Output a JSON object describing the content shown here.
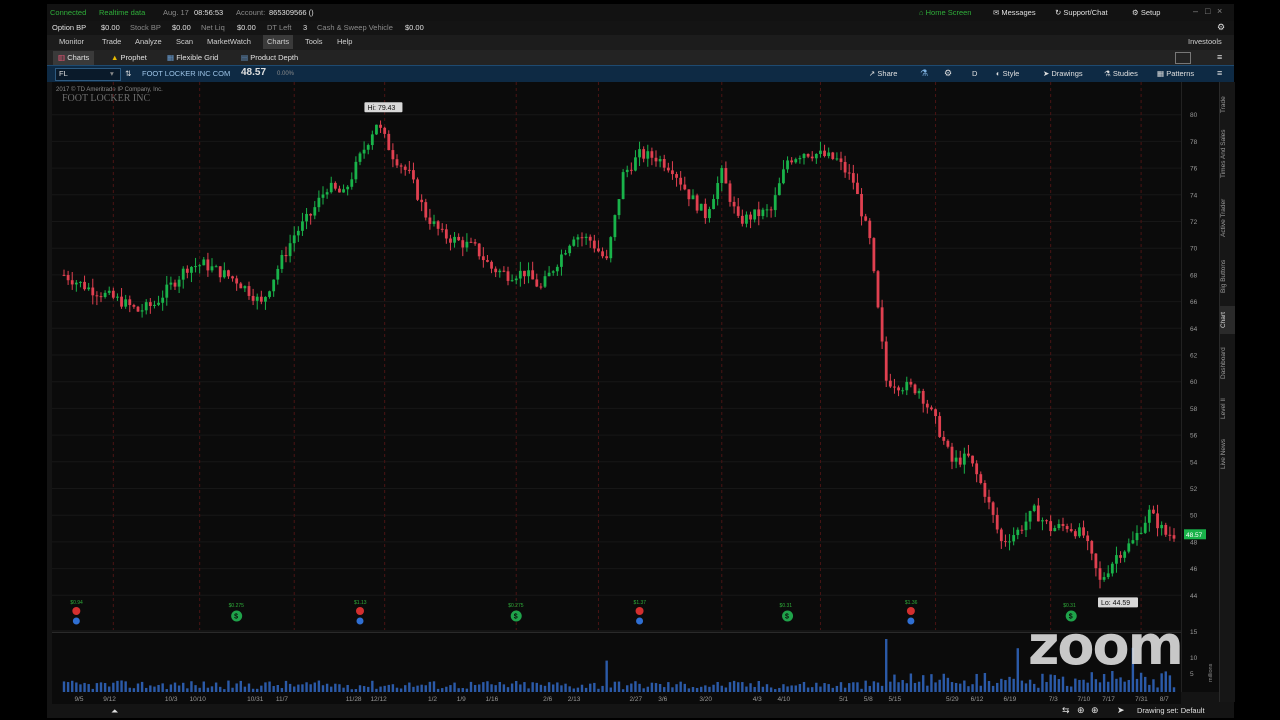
{
  "status": {
    "connected": "Connected",
    "realtime": "Realtime data",
    "date": "Aug. 17",
    "time": "08:56:53",
    "account_label": "Account:",
    "account_value": "865309566 ()"
  },
  "top_right": {
    "home_screen": "Home Screen",
    "messages": "Messages",
    "support": "Support/Chat",
    "setup": "Setup"
  },
  "balances": [
    {
      "label": "Option BP",
      "value": "$0.00"
    },
    {
      "label": "Stock BP",
      "value": "$0.00"
    },
    {
      "label": "Net Liq",
      "value": "$0.00"
    },
    {
      "label": "DT Left",
      "value": "3"
    },
    {
      "label": "Cash & Sweep Vehicle",
      "value": "$0.00"
    }
  ],
  "menu": [
    "Monitor",
    "Trade",
    "Analyze",
    "Scan",
    "MarketWatch",
    "Charts",
    "Tools",
    "Help"
  ],
  "menu_active": "Charts",
  "user_label": "Investools",
  "subtabs": [
    "Charts",
    "Prophet",
    "Flexible Grid",
    "Product Depth"
  ],
  "symbol_bar": {
    "symbol": "FL",
    "company": "FOOT LOCKER INC COM",
    "price": "48.57",
    "change": "0.00%",
    "period": "D",
    "buttons": [
      "Share",
      "Style",
      "Drawings",
      "Studies",
      "Patterns"
    ]
  },
  "chart_header": {
    "copyright": "2017 © TD Ameritrade IP Company, Inc.",
    "name": "FOOT LOCKER INC"
  },
  "chart_data": {
    "type": "candlestick",
    "title": "FOOT LOCKER INC",
    "ylim": [
      42,
      82
    ],
    "yticks": [
      44,
      46,
      48,
      50,
      52,
      54,
      56,
      58,
      60,
      62,
      64,
      66,
      68,
      70,
      72,
      74,
      76,
      78,
      80
    ],
    "xticks": [
      "9/5",
      "9/12",
      "10/3",
      "10/10",
      "10/31",
      "11/7",
      "11/28",
      "12/12",
      "1/2",
      "1/9",
      "1/16",
      "2/6",
      "2/13",
      "2/27",
      "3/6",
      "3/20",
      "4/3",
      "4/10",
      "5/1",
      "5/8",
      "5/15",
      "5/29",
      "6/12",
      "6/19",
      "7/3",
      "7/10",
      "7/17",
      "7/31",
      "8/7"
    ],
    "hi_label": "Hi: 79.43",
    "lo_label": "Lo: 44.59",
    "last_price": "48.57",
    "close_path": [
      [
        0,
        68
      ],
      [
        6,
        67
      ],
      [
        10,
        66.5
      ],
      [
        14,
        66
      ],
      [
        18,
        65.3
      ],
      [
        22,
        65.8
      ],
      [
        26,
        67.2
      ],
      [
        30,
        68.6
      ],
      [
        34,
        68.8
      ],
      [
        38,
        68.2
      ],
      [
        42,
        67.6
      ],
      [
        46,
        66.5
      ],
      [
        48,
        65.8
      ],
      [
        52,
        68.5
      ],
      [
        56,
        71
      ],
      [
        60,
        72.5
      ],
      [
        64,
        74.6
      ],
      [
        68,
        74
      ],
      [
        72,
        76.8
      ],
      [
        76,
        79.4
      ],
      [
        80,
        77
      ],
      [
        84,
        75.5
      ],
      [
        88,
        72.5
      ],
      [
        92,
        71
      ],
      [
        96,
        70.5
      ],
      [
        100,
        70
      ],
      [
        104,
        68.5
      ],
      [
        108,
        68
      ],
      [
        112,
        68.2
      ],
      [
        116,
        67
      ],
      [
        120,
        69
      ],
      [
        124,
        71
      ],
      [
        128,
        70.6
      ],
      [
        132,
        69
      ],
      [
        136,
        75.5
      ],
      [
        140,
        77
      ],
      [
        144,
        76.8
      ],
      [
        148,
        76
      ],
      [
        152,
        74
      ],
      [
        156,
        72.5
      ],
      [
        160,
        75.6
      ],
      [
        164,
        72
      ],
      [
        168,
        72.5
      ],
      [
        172,
        72.8
      ],
      [
        176,
        76.6
      ],
      [
        180,
        77.2
      ],
      [
        184,
        77
      ],
      [
        188,
        76.6
      ],
      [
        192,
        75
      ],
      [
        196,
        70.5
      ],
      [
        200,
        60.1
      ],
      [
        204,
        59.7
      ],
      [
        208,
        59.4
      ],
      [
        212,
        57
      ],
      [
        216,
        54
      ],
      [
        220,
        54.3
      ],
      [
        224,
        51.7
      ],
      [
        228,
        48
      ],
      [
        232,
        48.8
      ],
      [
        236,
        50.3
      ],
      [
        240,
        49
      ],
      [
        244,
        49.2
      ],
      [
        248,
        48.5
      ],
      [
        252,
        45
      ],
      [
        256,
        47
      ],
      [
        260,
        48
      ],
      [
        264,
        50.2
      ],
      [
        268,
        48.57
      ]
    ],
    "volume_scale": [
      "15",
      "10",
      "5"
    ],
    "volume_unit": "millions",
    "events": {
      "dividends": [
        "$0.275",
        "$0.275",
        "$0.31",
        "$0.31"
      ],
      "earnings": [
        "$0.94",
        "$1.13",
        "$1.37",
        "$1.36"
      ]
    }
  },
  "sidebar": [
    "Trade",
    "Times And Sales",
    "Active Trader",
    "Big Buttons",
    "Chart",
    "Dashboard",
    "Level II",
    "Live News"
  ],
  "footer": {
    "drawing_set": "Drawing set: Default"
  },
  "watermark": "zoom"
}
